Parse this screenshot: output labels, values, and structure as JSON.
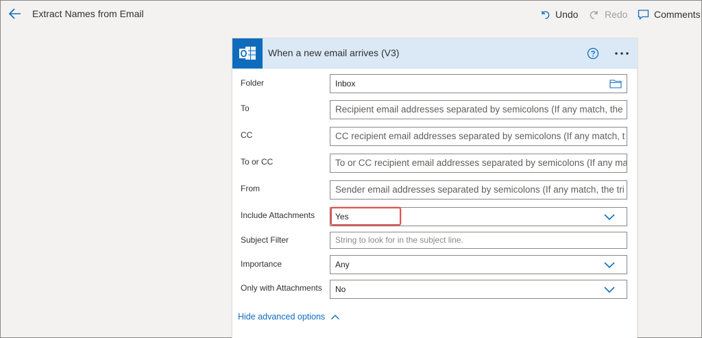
{
  "app": {
    "flow_title": "Extract Names from Email"
  },
  "toolbar": {
    "undo_label": "Undo",
    "redo_label": "Redo",
    "comments_label": "Comments"
  },
  "trigger": {
    "title": "When a new email arrives (V3)",
    "fields": [
      {
        "label": "Folder",
        "value": "Inbox",
        "placeholder": ""
      },
      {
        "label": "To",
        "value": "",
        "placeholder": "Recipient email addresses separated by semicolons (If any match, the"
      },
      {
        "label": "CC",
        "value": "",
        "placeholder": "CC recipient email addresses separated by semicolons (If any match, t"
      },
      {
        "label": "To or CC",
        "value": "",
        "placeholder": "To or CC recipient email addresses separated by semicolons (If any ma"
      },
      {
        "label": "From",
        "value": "",
        "placeholder": "Sender email addresses separated by semicolons (If any match, the tri"
      },
      {
        "label": "Include Attachments",
        "value": "Yes",
        "placeholder": ""
      },
      {
        "label": "Subject Filter",
        "value": "",
        "placeholder": "String to look for in the subject line."
      },
      {
        "label": "Importance",
        "value": "Any",
        "placeholder": ""
      },
      {
        "label": "Only with Attachments",
        "value": "No",
        "placeholder": ""
      }
    ],
    "advanced_link": "Hide advanced options"
  },
  "colors": {
    "accent": "#0f6cbd",
    "header_bg": "#dbe9f7",
    "highlight": "#d9534f"
  },
  "icons": {
    "back": "arrow-left-icon",
    "undo": "undo-icon",
    "redo": "redo-icon",
    "comments": "comment-icon",
    "connector": "outlook-icon",
    "help": "help-icon",
    "more": "more-icon",
    "folder": "folder-icon",
    "dropdown": "chevron-down-icon",
    "collapse": "chevron-up-icon"
  }
}
